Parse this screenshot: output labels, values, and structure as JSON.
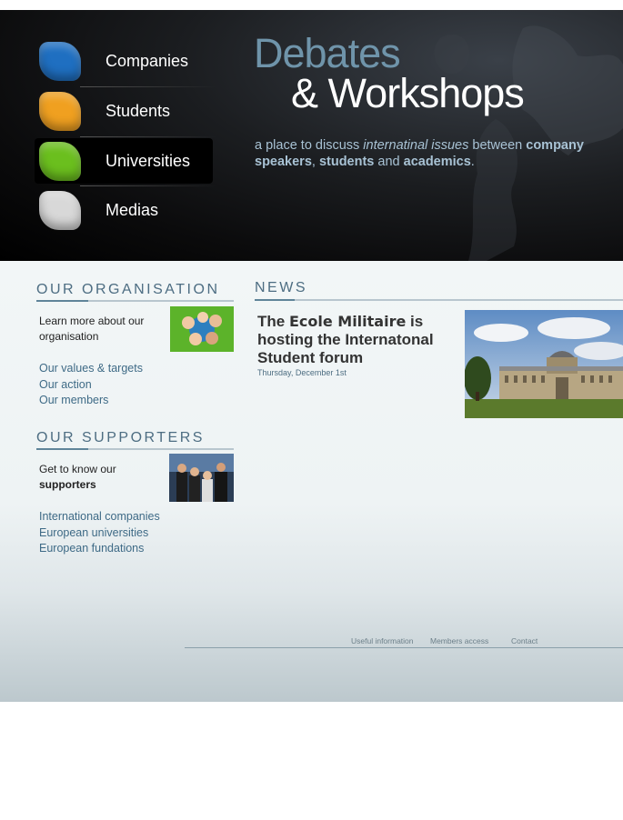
{
  "nav": {
    "items": [
      {
        "label": "Companies",
        "color": "#1f6fc1"
      },
      {
        "label": "Students",
        "color": "#f0a020"
      },
      {
        "label": "Universities",
        "color": "#6bbf1e"
      },
      {
        "label": "Medias",
        "color": "#d8d8d8"
      }
    ]
  },
  "hero": {
    "title_line1": "Debates",
    "title_line2": "& Workshops",
    "tagline": {
      "p1": "a place to discuss ",
      "p2": "internatinal issues",
      "p3": " between ",
      "p4": "company speakers",
      "p5": ", ",
      "p6": "students",
      "p7": " and ",
      "p8": "academics",
      "p9": "."
    }
  },
  "organisation": {
    "title": "OUR ORGANISATION",
    "intro": "Learn more about our organisation",
    "links": [
      "Our values & targets",
      "Our action",
      "Our members"
    ]
  },
  "supporters": {
    "title": "OUR SUPPORTERS",
    "intro_plain": "Get to know our ",
    "intro_bold": "supporters",
    "links": [
      "International companies",
      "European universities",
      "European fundations"
    ]
  },
  "news": {
    "title": "NEWS",
    "headline": {
      "p1": "The ",
      "p2": "Ecole Militaire",
      "p3": " is hosting the Internatonal Student forum"
    },
    "date": "Thursday, December 1st"
  },
  "footer": {
    "links": [
      "Useful information",
      "Members access",
      "Contact"
    ]
  },
  "colors": {
    "accent": "#4d6d82",
    "link": "#3e6a86",
    "tagline": "#a8c2d4"
  }
}
